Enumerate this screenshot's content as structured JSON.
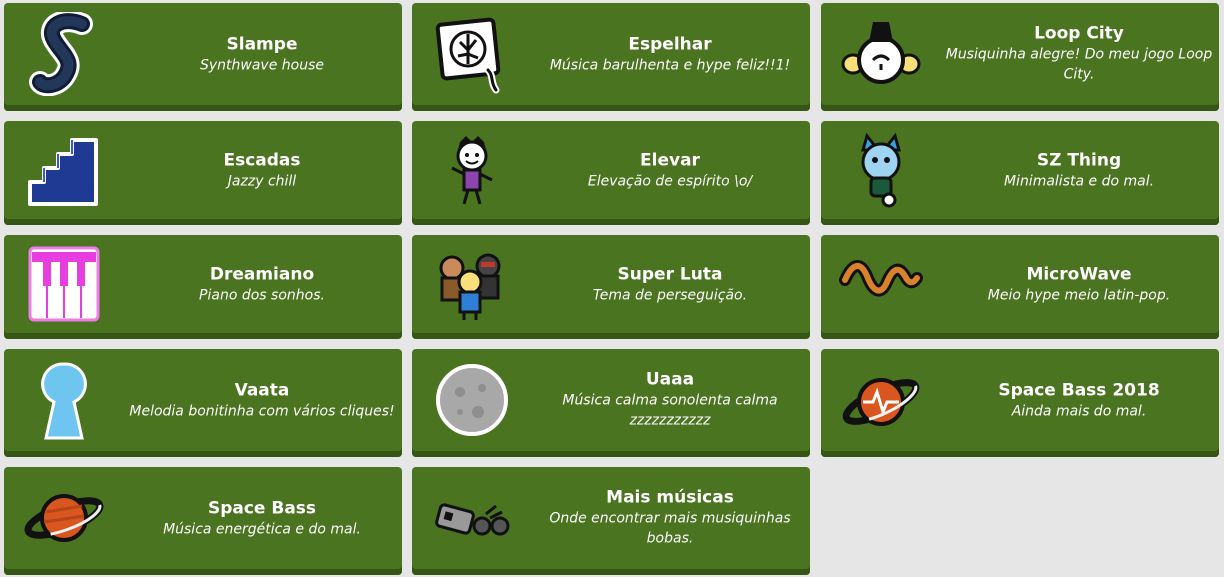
{
  "cards": [
    {
      "title": "Slampe",
      "subtitle": "Synthwave house",
      "icon": "serpent-s-icon"
    },
    {
      "title": "Espelhar",
      "subtitle": "Música barulhenta e hype feliz!!1!",
      "icon": "mirror-doodle-icon"
    },
    {
      "title": "Loop City",
      "subtitle": "Musiquinha alegre! Do meu jogo Loop City.",
      "icon": "loop-city-character-icon"
    },
    {
      "title": "Escadas",
      "subtitle": "Jazzy chill",
      "icon": "stairs-icon"
    },
    {
      "title": "Elevar",
      "subtitle": "Elevação de espírito \\o/",
      "icon": "cheering-kid-icon"
    },
    {
      "title": "SZ Thing",
      "subtitle": "Minimalista e do mal.",
      "icon": "blue-cat-character-icon"
    },
    {
      "title": "Dreamiano",
      "subtitle": "Piano dos sonhos.",
      "icon": "piano-keys-icon"
    },
    {
      "title": "Super Luta",
      "subtitle": "Tema de perseguição.",
      "icon": "fighters-group-icon"
    },
    {
      "title": "MicroWave",
      "subtitle": "Meio hype meio latin-pop.",
      "icon": "wave-snake-icon"
    },
    {
      "title": "Vaata",
      "subtitle": "Melodia bonitinha com vários cliques!",
      "icon": "keyhole-icon"
    },
    {
      "title": "Uaaa",
      "subtitle": "Música calma sonolenta calma zzzzzzzzzzz",
      "icon": "moon-icon"
    },
    {
      "title": "Space Bass 2018",
      "subtitle": "Ainda mais do mal.",
      "icon": "ringed-planet-heartbeat-icon"
    },
    {
      "title": "Space Bass",
      "subtitle": "Música energética e do mal.",
      "icon": "ringed-planet-icon"
    },
    {
      "title": "Mais músicas",
      "subtitle": "Onde encontrar mais musiquinhas bobas.",
      "icon": "music-gadgets-icon"
    }
  ],
  "colors": {
    "page_background": "#e6e6e6",
    "card_background": "#4a7420",
    "card_shadow": "#355615",
    "text": "#ffffff"
  }
}
